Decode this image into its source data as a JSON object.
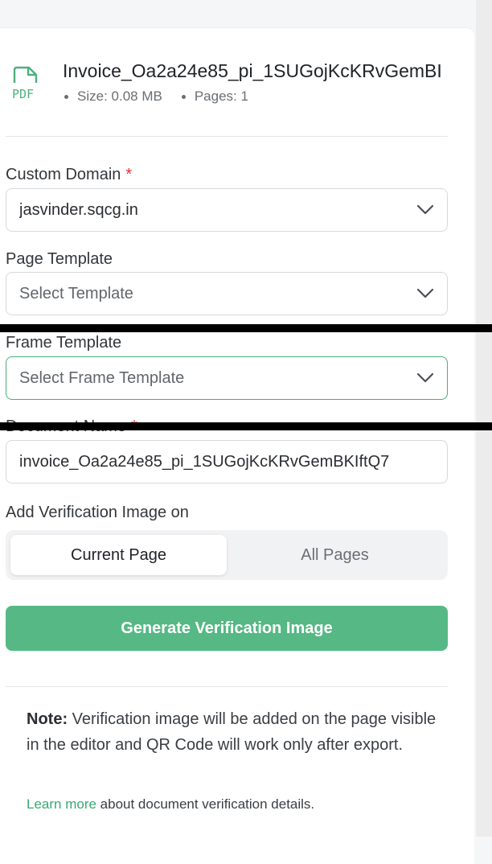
{
  "file": {
    "icon_text": "PDF",
    "name": "Invoice_Oa2a24e85_pi_1SUGojKcKRvGemBI",
    "size": "Size: 0.08 MB",
    "pages": "Pages: 1"
  },
  "custom_domain": {
    "label": "Custom Domain",
    "required_mark": "*",
    "value": "jasvinder.sqcg.in"
  },
  "page_template": {
    "label": "Page Template",
    "placeholder": "Select Template"
  },
  "frame_template": {
    "label": "Frame Template",
    "placeholder": "Select Frame Template"
  },
  "document_name": {
    "label": "Document Name",
    "required_mark": "*",
    "value": "invoice_Oa2a24e85_pi_1SUGojKcKRvGemBKIftQ7"
  },
  "verification": {
    "label": "Add Verification Image on",
    "options": [
      "Current Page",
      "All Pages"
    ],
    "selected": "Current Page"
  },
  "generate_button": "Generate Verification Image",
  "note": {
    "prefix": "Note:",
    "text": " Verification image will be added on the page visible in the editor and QR Code will work only after export."
  },
  "learn_more": {
    "link": "Learn more",
    "text": " about document verification details."
  },
  "colors": {
    "accent": "#56b884",
    "link": "#3aa872",
    "required": "#e03131"
  }
}
